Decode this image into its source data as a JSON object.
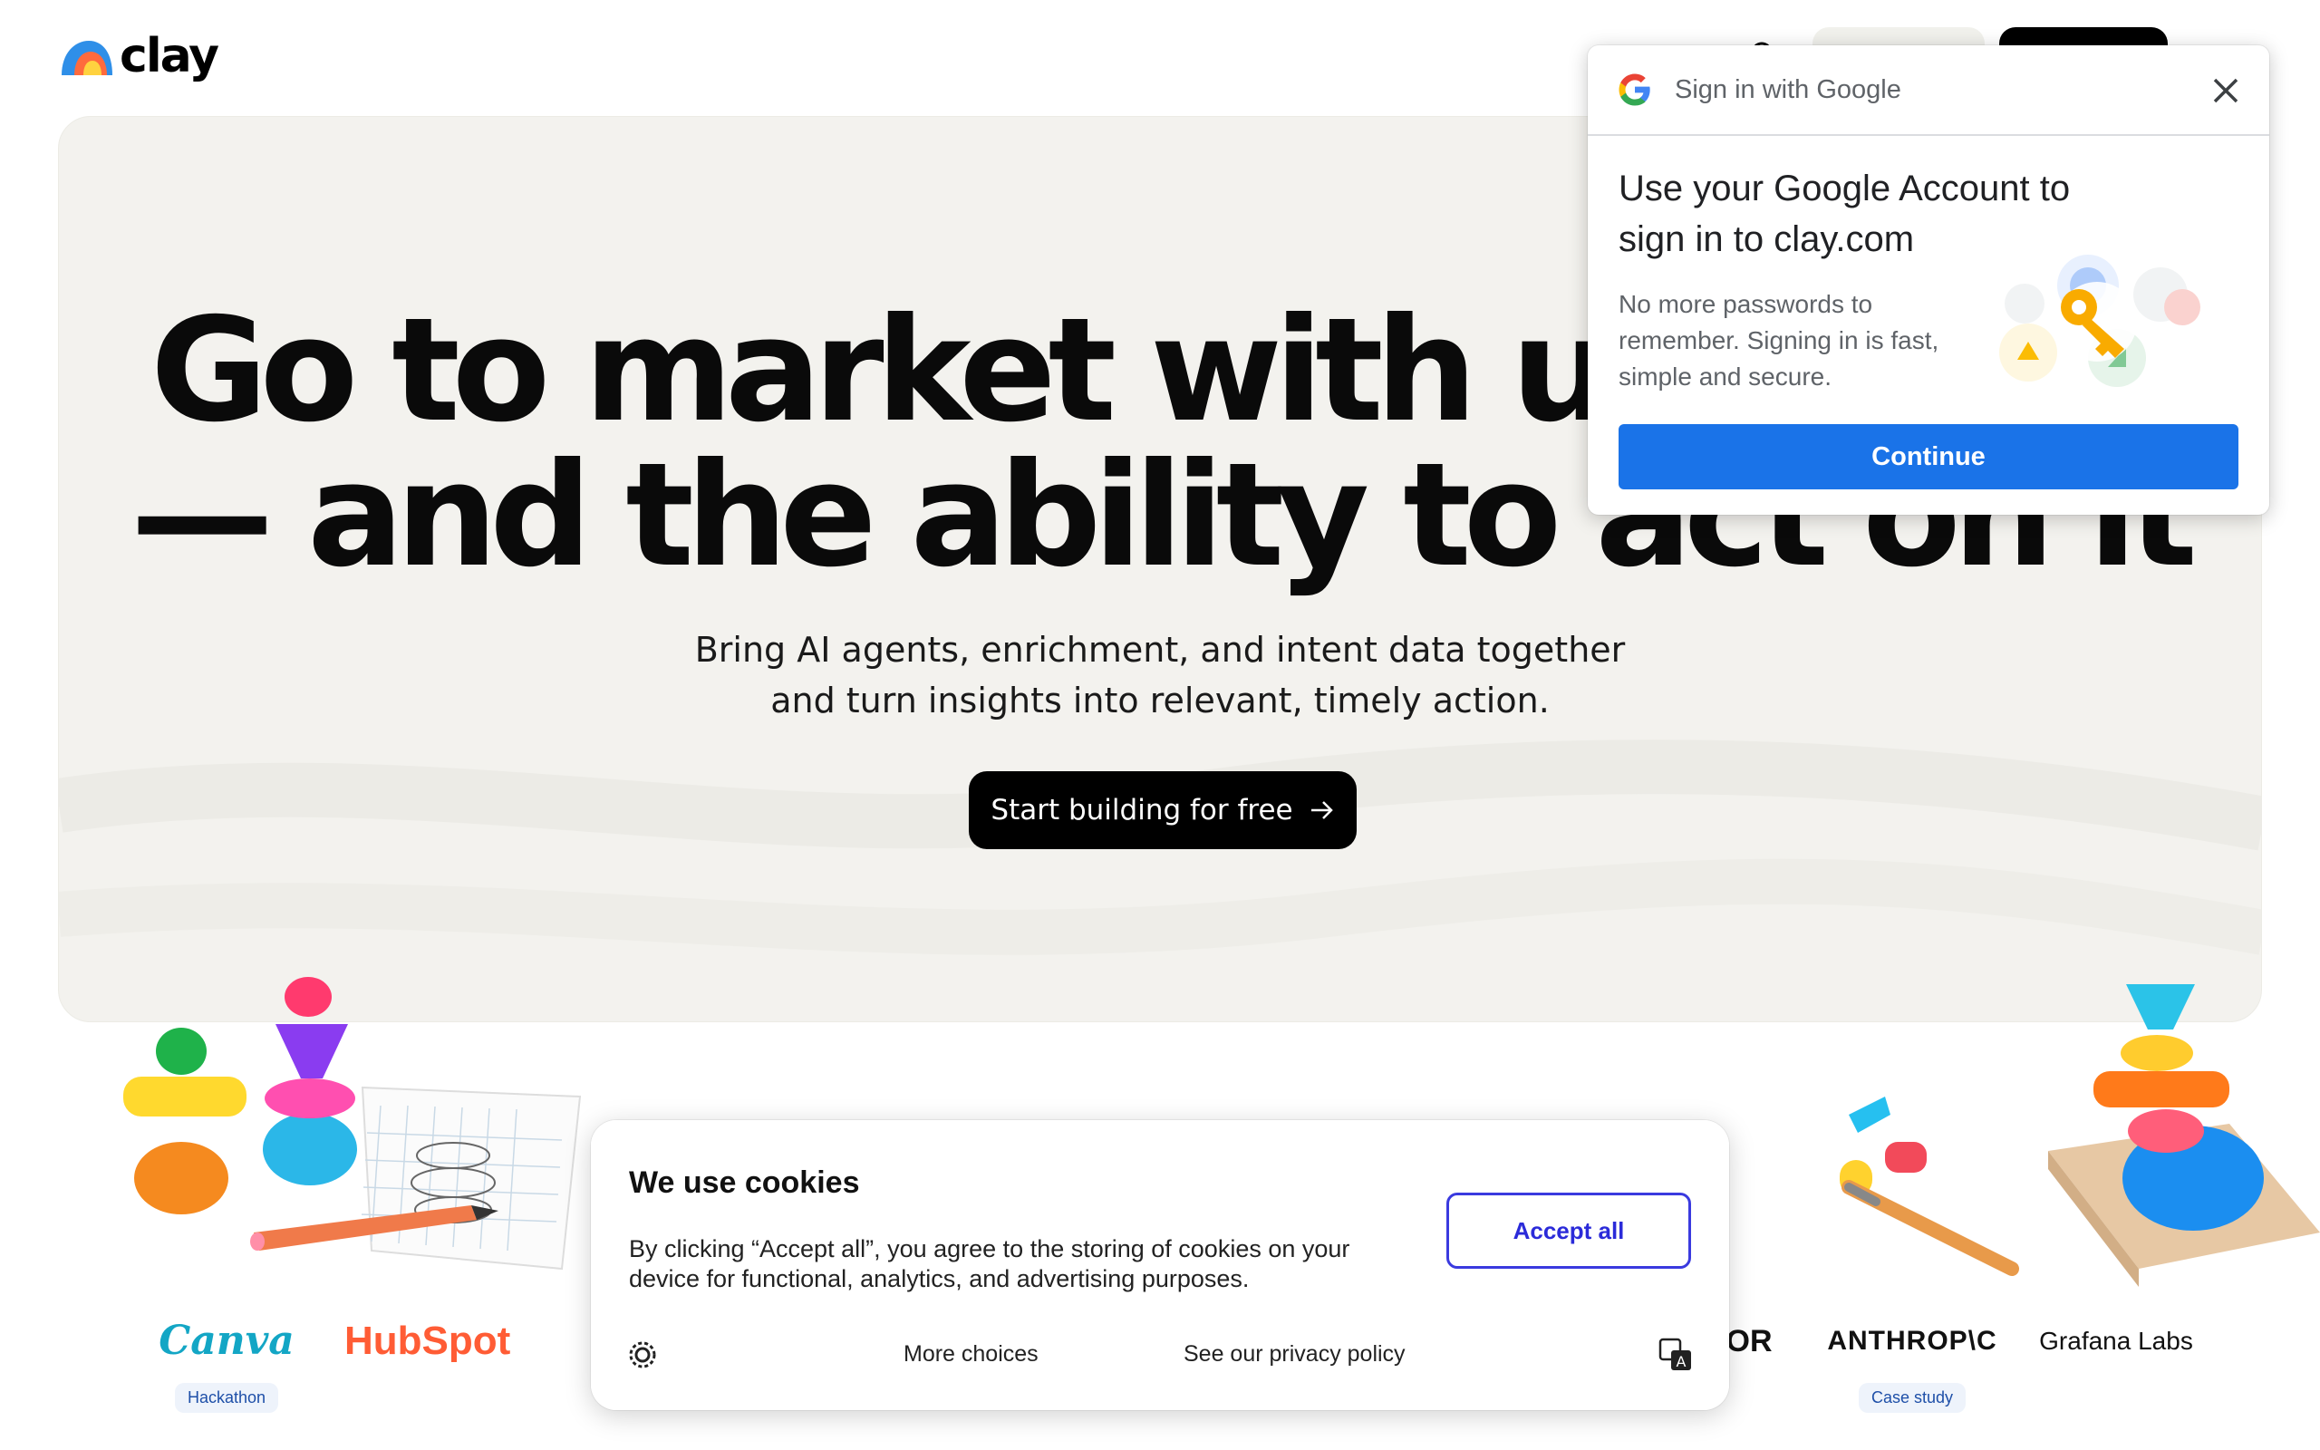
{
  "header": {
    "logo_text": "clay",
    "icons": {
      "search": "search-icon",
      "menu": "menu-icon"
    }
  },
  "hero": {
    "title_line1": "Go to market with unic",
    "title_line2": "— and the ability to act on it",
    "subtitle_line1": "Bring AI agents, enrichment, and intent data together",
    "subtitle_line2": "and turn insights into relevant, timely action.",
    "cta_label": "Start building for free",
    "cta_icon": "arrow-right-icon"
  },
  "brands": [
    {
      "name": "Canva",
      "badge": "Hackathon",
      "color": "#13a6c5"
    },
    {
      "name": "HubSpot",
      "badge": "",
      "color": "#ff5c35"
    },
    {
      "name": "OR",
      "badge": "",
      "color": "#111111"
    },
    {
      "name": "ANTHROP\\C",
      "badge": "Case study",
      "color": "#111111"
    },
    {
      "name": "Grafana Labs",
      "badge": "",
      "color": "#f05a28"
    }
  ],
  "google_signin": {
    "header_title": "Sign in with Google",
    "title": "Use your Google Account to sign in to clay.com",
    "description": "No more passwords to remember. Signing in is fast, simple and secure.",
    "continue_label": "Continue",
    "colors": {
      "button": "#1a73e8"
    }
  },
  "cookie_banner": {
    "title": "We use cookies",
    "text": "By clicking “Accept all”, you agree to the storing of cookies on your device for functional, analytics, and advertising purposes.",
    "accept_label": "Accept all",
    "more_choices_label": "More choices",
    "privacy_label": "See our privacy policy",
    "colors": {
      "accent": "#2b2bd9"
    }
  }
}
